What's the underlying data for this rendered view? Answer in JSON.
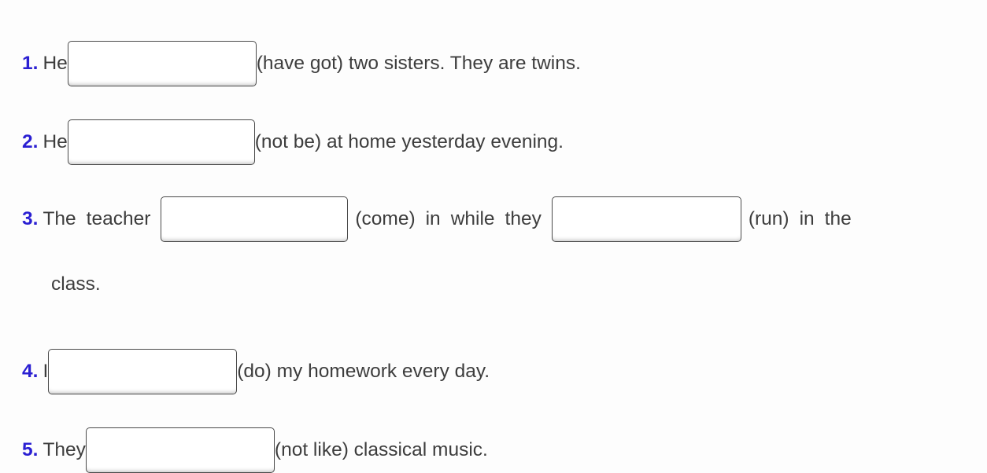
{
  "page": {
    "background_color": "#fdfdfd",
    "text_color": "#3d3d3d",
    "number_color": "#2a1fd2"
  },
  "exercises": [
    {
      "number": "1.",
      "before_blank": "He",
      "after_blank": "(have got) two sisters. They are twins.",
      "blank_value": "",
      "blank_placeholder": ""
    },
    {
      "number": "2.",
      "before_blank": "He",
      "after_blank": "(not be) at home yesterday evening.",
      "blank_value": "",
      "blank_placeholder": ""
    },
    {
      "number": "3.",
      "before_blank": "The",
      "word2": "teacher",
      "mid_1": "(come)",
      "mid_2": "in",
      "mid_3": "while",
      "mid_4": "they",
      "after_blank_1": "(run)",
      "after_blank_2": "in",
      "after_blank_3": "the",
      "continuation": "class.",
      "blank_value": "",
      "blank_value_2": "",
      "blank_placeholder": ""
    },
    {
      "number": "4.",
      "before_blank": "I",
      "after_blank": "(do) my homework every day.",
      "blank_value": "",
      "blank_placeholder": ""
    },
    {
      "number": "5.",
      "before_blank": "They",
      "after_blank": "(not like) classical music.",
      "blank_value": "",
      "blank_placeholder": ""
    }
  ]
}
